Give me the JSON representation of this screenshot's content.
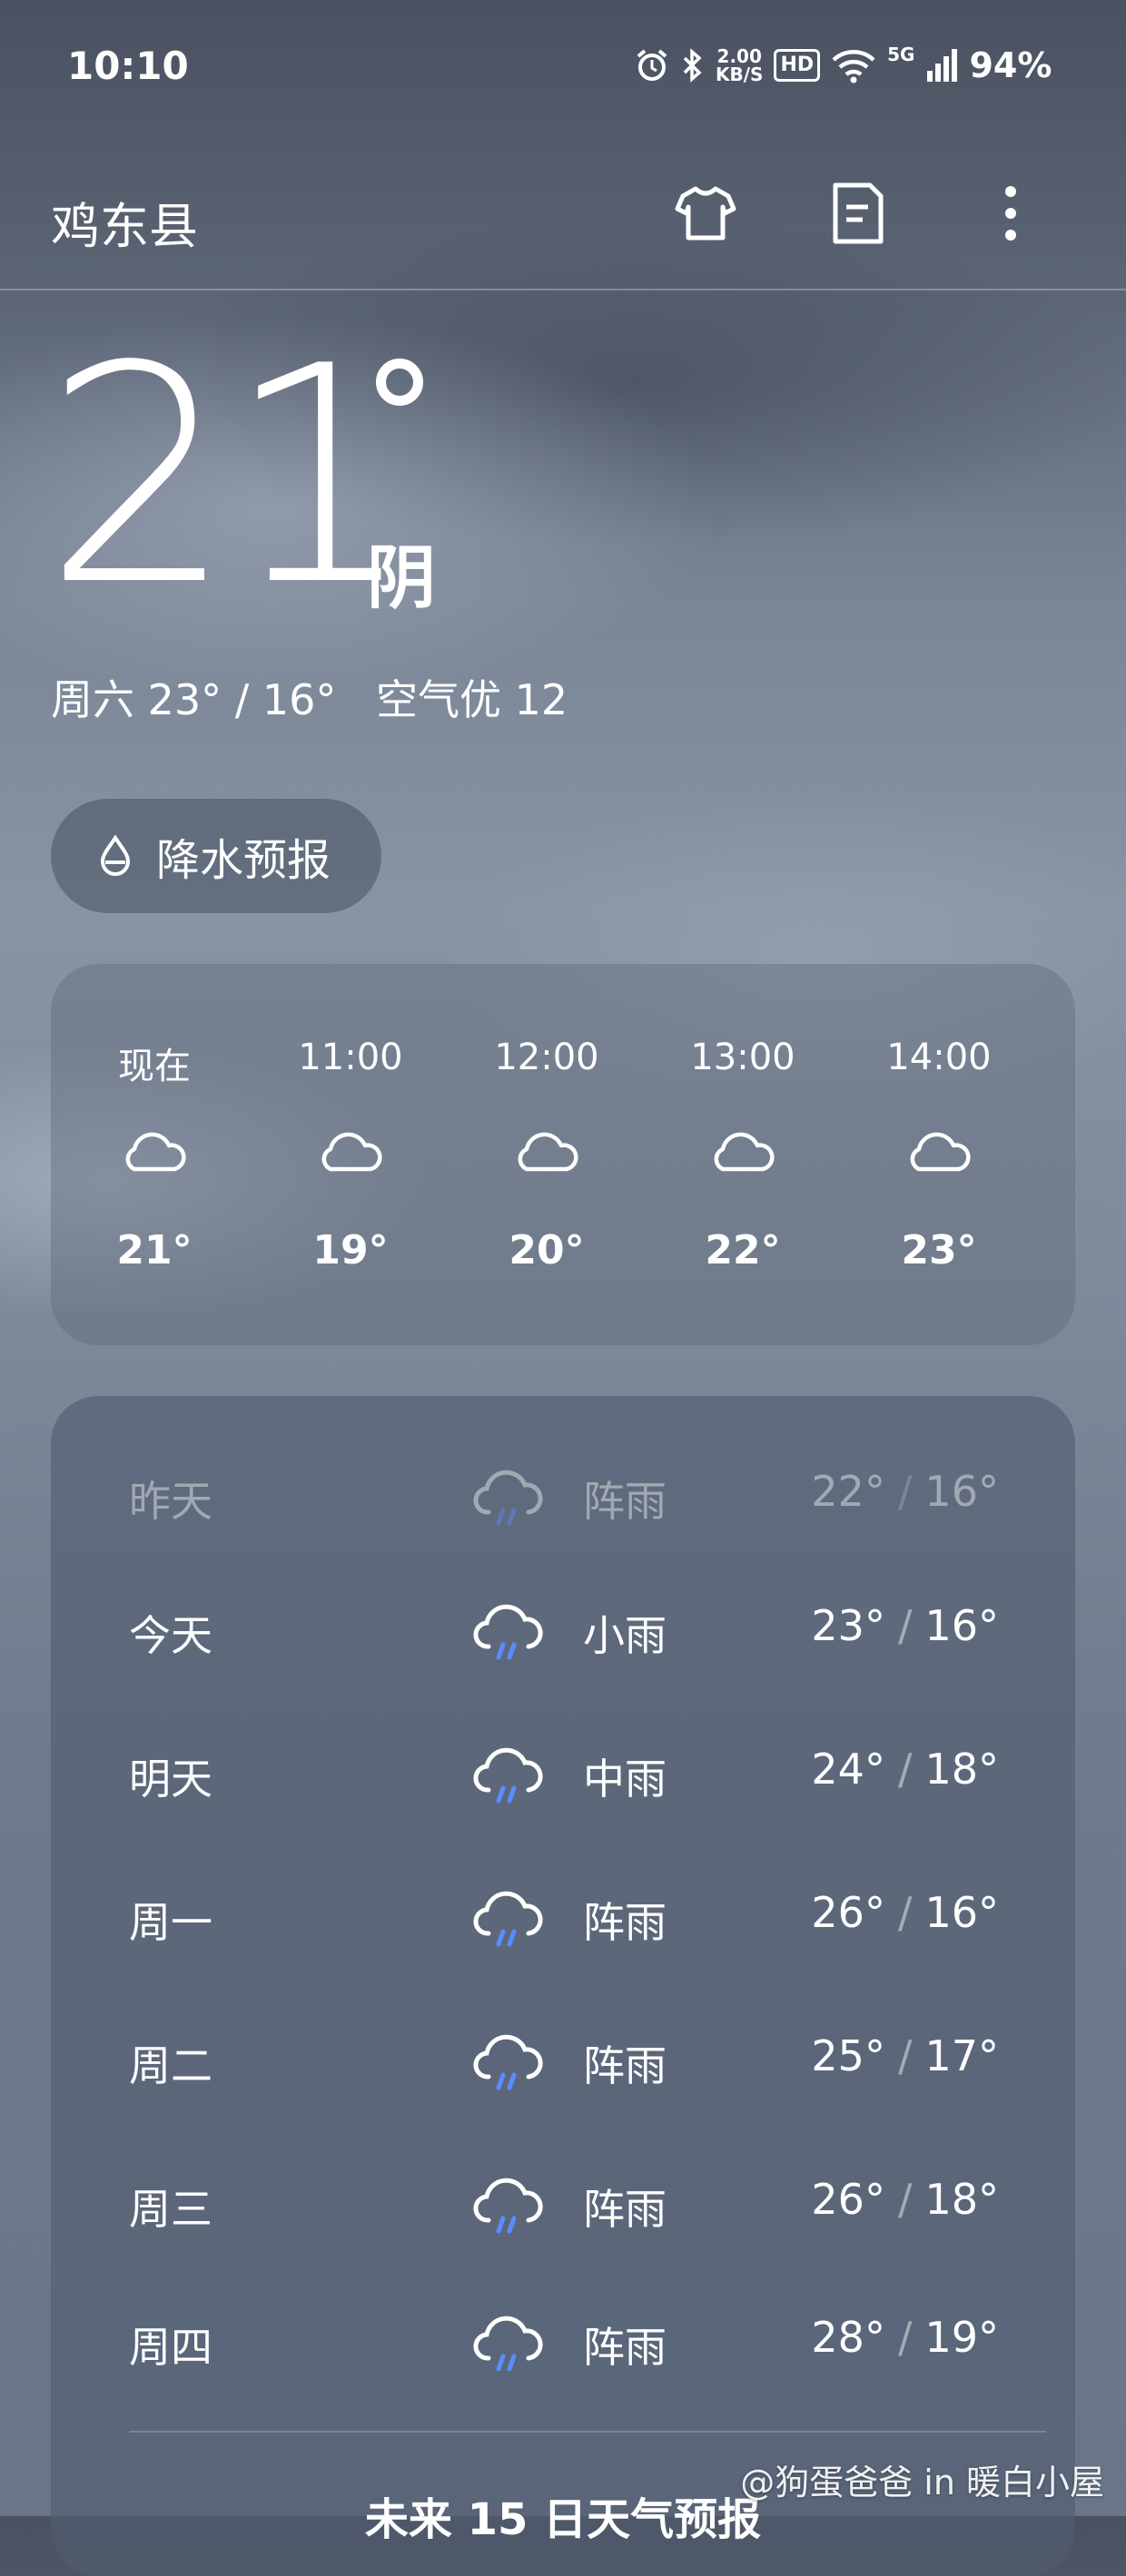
{
  "status_bar": {
    "time": "10:10",
    "net_speed_value": "2.00",
    "net_speed_unit": "KB/S",
    "hd_label": "HD",
    "network_label": "5G",
    "battery": "94%"
  },
  "header": {
    "city": "鸡东县",
    "icons": [
      "tshirt-icon",
      "document-icon",
      "more-vert-icon"
    ]
  },
  "current": {
    "temperature": "21",
    "condition": "阴",
    "hi_lo": "周六 23° / 16°",
    "air_quality": "空气优 12"
  },
  "precip_button": {
    "label": "降水预报",
    "icon": "drop-icon"
  },
  "hourly": [
    {
      "time": "现在",
      "icon": "cloud-icon",
      "temp": "21°"
    },
    {
      "time": "11:00",
      "icon": "cloud-icon",
      "temp": "19°"
    },
    {
      "time": "12:00",
      "icon": "cloud-icon",
      "temp": "20°"
    },
    {
      "time": "13:00",
      "icon": "cloud-icon",
      "temp": "22°"
    },
    {
      "time": "14:00",
      "icon": "cloud-icon",
      "temp": "23°"
    }
  ],
  "daily": [
    {
      "day": "昨天",
      "condition": "阵雨",
      "high": "22°",
      "low": "16°",
      "icon": "rain-cloud-icon"
    },
    {
      "day": "今天",
      "condition": "小雨",
      "high": "23°",
      "low": "16°",
      "icon": "rain-cloud-icon"
    },
    {
      "day": "明天",
      "condition": "中雨",
      "high": "24°",
      "low": "18°",
      "icon": "rain-cloud-icon"
    },
    {
      "day": "周一",
      "condition": "阵雨",
      "high": "26°",
      "low": "16°",
      "icon": "rain-cloud-icon"
    },
    {
      "day": "周二",
      "condition": "阵雨",
      "high": "25°",
      "low": "17°",
      "icon": "rain-cloud-icon"
    },
    {
      "day": "周三",
      "condition": "阵雨",
      "high": "26°",
      "low": "18°",
      "icon": "rain-cloud-icon"
    },
    {
      "day": "周四",
      "condition": "阵雨",
      "high": "28°",
      "low": "19°",
      "icon": "rain-cloud-icon"
    }
  ],
  "forecast_link": "未来 15 日天气预报",
  "watermark": "@狗蛋爸爸 in 暖白小屋",
  "colors": {
    "rain_accent": "#5b8cff",
    "card_bg": "#5a6478"
  }
}
